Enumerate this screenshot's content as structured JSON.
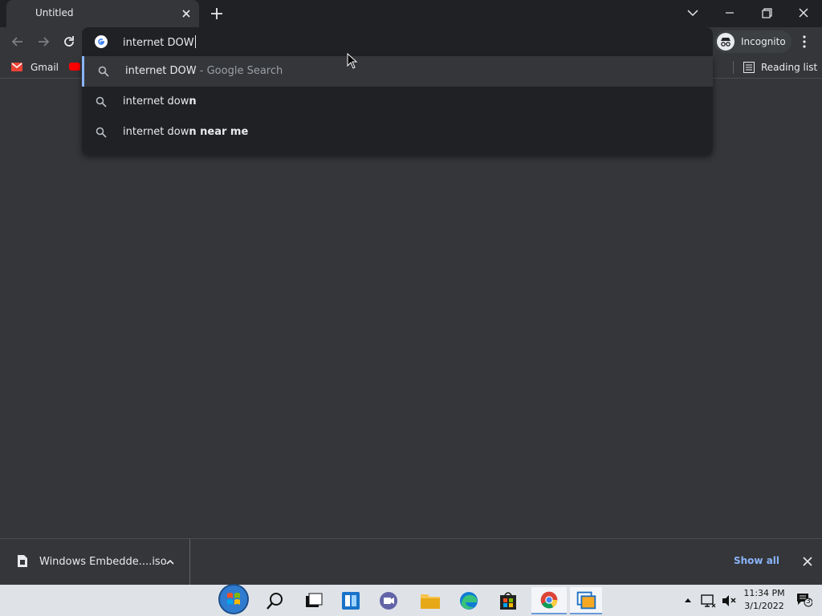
{
  "tab": {
    "title": "Untitled"
  },
  "omnibox": {
    "value": "internet DOW"
  },
  "incognito": {
    "label": "Incognito"
  },
  "bookmarks": {
    "gmail": "Gmail",
    "reading_list": "Reading list"
  },
  "suggestions": [
    {
      "typed": "internet DOW",
      "rest": "",
      "suffix": " - Google Search",
      "icon": "search-icon"
    },
    {
      "typed": "internet dow",
      "rest": "n",
      "suffix": "",
      "icon": "search-icon"
    },
    {
      "typed": "internet dow",
      "rest": "n near me",
      "suffix": "",
      "icon": "search-icon"
    }
  ],
  "downloads": {
    "file_name": "Windows Embedde....iso",
    "show_all": "Show all"
  },
  "system_tray": {
    "time": "11:34 PM",
    "date": "3/1/2022",
    "notification_count": "3"
  },
  "colors": {
    "accent_blue": "#8ab4f8",
    "toolbar": "#35363a",
    "frame": "#202124"
  }
}
